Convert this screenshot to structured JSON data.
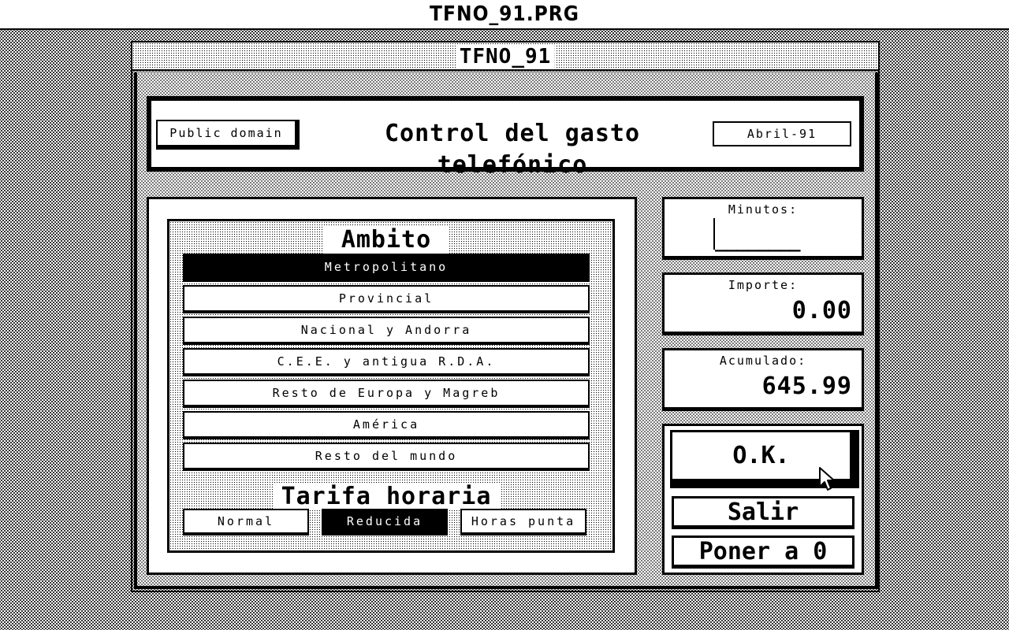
{
  "desktop": {
    "program_title": "TFNO_91.PRG"
  },
  "window": {
    "title": "TFNO_91"
  },
  "header": {
    "badge": "Public domain",
    "title": "Control del gasto telefónico",
    "date": "Abril-91"
  },
  "ambito": {
    "title": "Ambito",
    "selected_index": 0,
    "options": [
      {
        "label": "Metropolitano"
      },
      {
        "label": "Provincial"
      },
      {
        "label": "Nacional y Andorra"
      },
      {
        "label": "C.E.E. y antigua R.D.A."
      },
      {
        "label": "Resto de Europa y Magreb"
      },
      {
        "label": "América"
      },
      {
        "label": "Resto del mundo"
      }
    ]
  },
  "tarifa": {
    "title": "Tarifa horaria",
    "selected_index": 1,
    "options": [
      {
        "label": "Normal"
      },
      {
        "label": "Reducida"
      },
      {
        "label": "Horas punta"
      }
    ]
  },
  "minutos": {
    "label": "Minutos:",
    "value": "________"
  },
  "importe": {
    "label": "Importe:",
    "value": "0.00"
  },
  "acumulado": {
    "label": "Acumulado:",
    "value": "645.99"
  },
  "buttons": {
    "ok": "O.K.",
    "salir": "Salir",
    "poner_a_0": "Poner a 0"
  },
  "icons": {
    "pointer": "mouse-arrow-icon"
  }
}
